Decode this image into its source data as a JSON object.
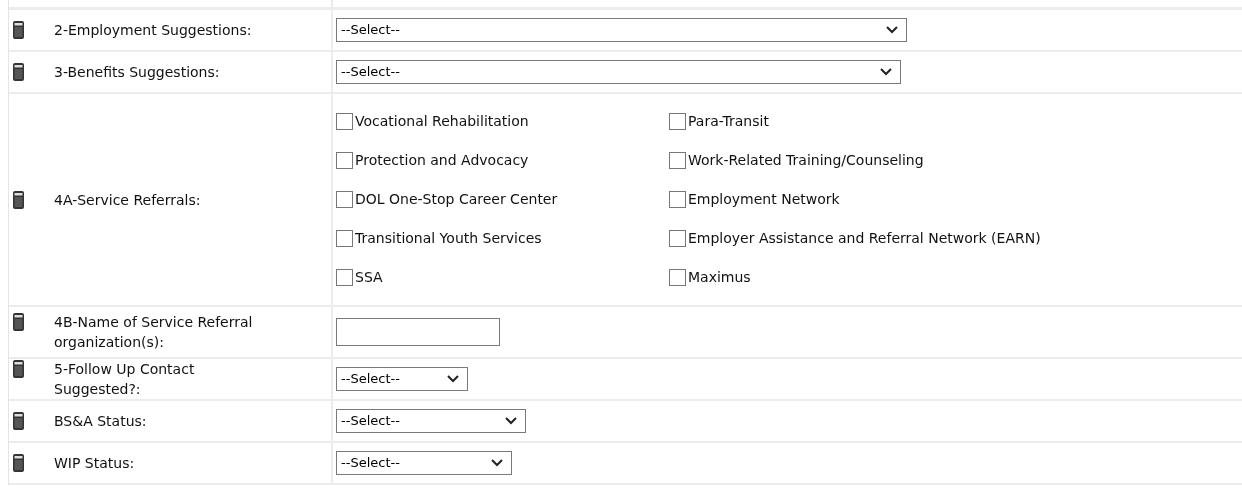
{
  "rows": [
    {
      "kind": "select",
      "label": "2-Employment Suggestions:",
      "value": "--Select--"
    },
    {
      "kind": "select",
      "label": "3-Benefits Suggestions:",
      "value": "--Select--"
    },
    {
      "kind": "checkboxes",
      "label": "4A-Service Referrals:",
      "options": [
        {
          "label": "Vocational Rehabilitation",
          "checked": false
        },
        {
          "label": "Para-Transit",
          "checked": false
        },
        {
          "label": "Protection and Advocacy",
          "checked": false
        },
        {
          "label": "Work-Related Training/Counseling",
          "checked": false
        },
        {
          "label": "DOL One-Stop Career Center",
          "checked": false
        },
        {
          "label": "Employment Network",
          "checked": false
        },
        {
          "label": "Transitional Youth Services",
          "checked": false
        },
        {
          "label": "Employer Assistance and Referral Network (EARN)",
          "checked": false
        },
        {
          "label": "SSA",
          "checked": false
        },
        {
          "label": "Maximus",
          "checked": false
        }
      ]
    },
    {
      "kind": "text",
      "label": "4B-Name of Service Referral organization(s):"
    },
    {
      "kind": "select",
      "label": "5-Follow Up Contact Suggested?:",
      "value": "--Select--"
    },
    {
      "kind": "select",
      "label": "BS&A Status:",
      "value": "--Select--"
    },
    {
      "kind": "select",
      "label": "WIP Status:",
      "value": "--Select--"
    }
  ]
}
